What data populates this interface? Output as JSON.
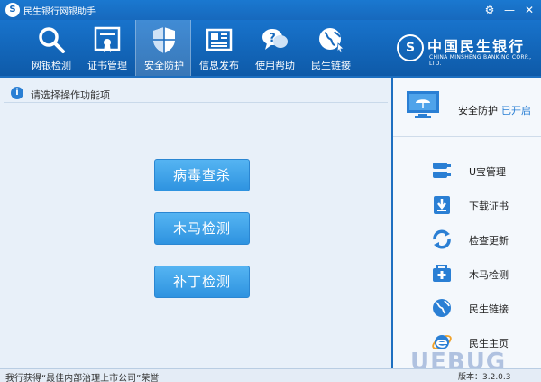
{
  "window": {
    "title": "民生银行网银助手",
    "logo_glyph": "S",
    "settings_glyph": "⚙",
    "minimize_glyph": "—",
    "close_glyph": "✕"
  },
  "nav": [
    {
      "label": "网银检测",
      "icon": "magnifier-icon"
    },
    {
      "label": "证书管理",
      "icon": "certificate-icon"
    },
    {
      "label": "安全防护",
      "icon": "shield-icon",
      "active": true
    },
    {
      "label": "信息发布",
      "icon": "newspaper-icon"
    },
    {
      "label": "使用帮助",
      "icon": "help-bubble-icon"
    },
    {
      "label": "民生链接",
      "icon": "globe-icon"
    }
  ],
  "brand": {
    "mark": "S",
    "name": "中国民生银行",
    "english": "CHINA MINSHENG BANKING CORP., LTD."
  },
  "main": {
    "hint": "请选择操作功能项",
    "info_glyph": "i",
    "buttons": [
      "病毒查杀",
      "木马检测",
      "补丁检测"
    ]
  },
  "side": {
    "status_label": "安全防护",
    "status_value": "已开启",
    "items": [
      {
        "label": "U宝管理",
        "icon": "usb-key-icon"
      },
      {
        "label": "下载证书",
        "icon": "download-icon"
      },
      {
        "label": "检查更新",
        "icon": "refresh-icon"
      },
      {
        "label": "木马检测",
        "icon": "medical-kit-icon"
      },
      {
        "label": "民生链接",
        "icon": "globe-icon"
      },
      {
        "label": "民生主页",
        "icon": "ie-browser-icon"
      }
    ]
  },
  "statusbar": {
    "text": "我行获得“最佳内部治理上市公司”荣誉",
    "version": "版本：3.2.0.3"
  },
  "watermark": "UEBUG",
  "colors": {
    "header": "#1769bd",
    "accent": "#2e93e0",
    "panel": "#e8f0f9"
  }
}
